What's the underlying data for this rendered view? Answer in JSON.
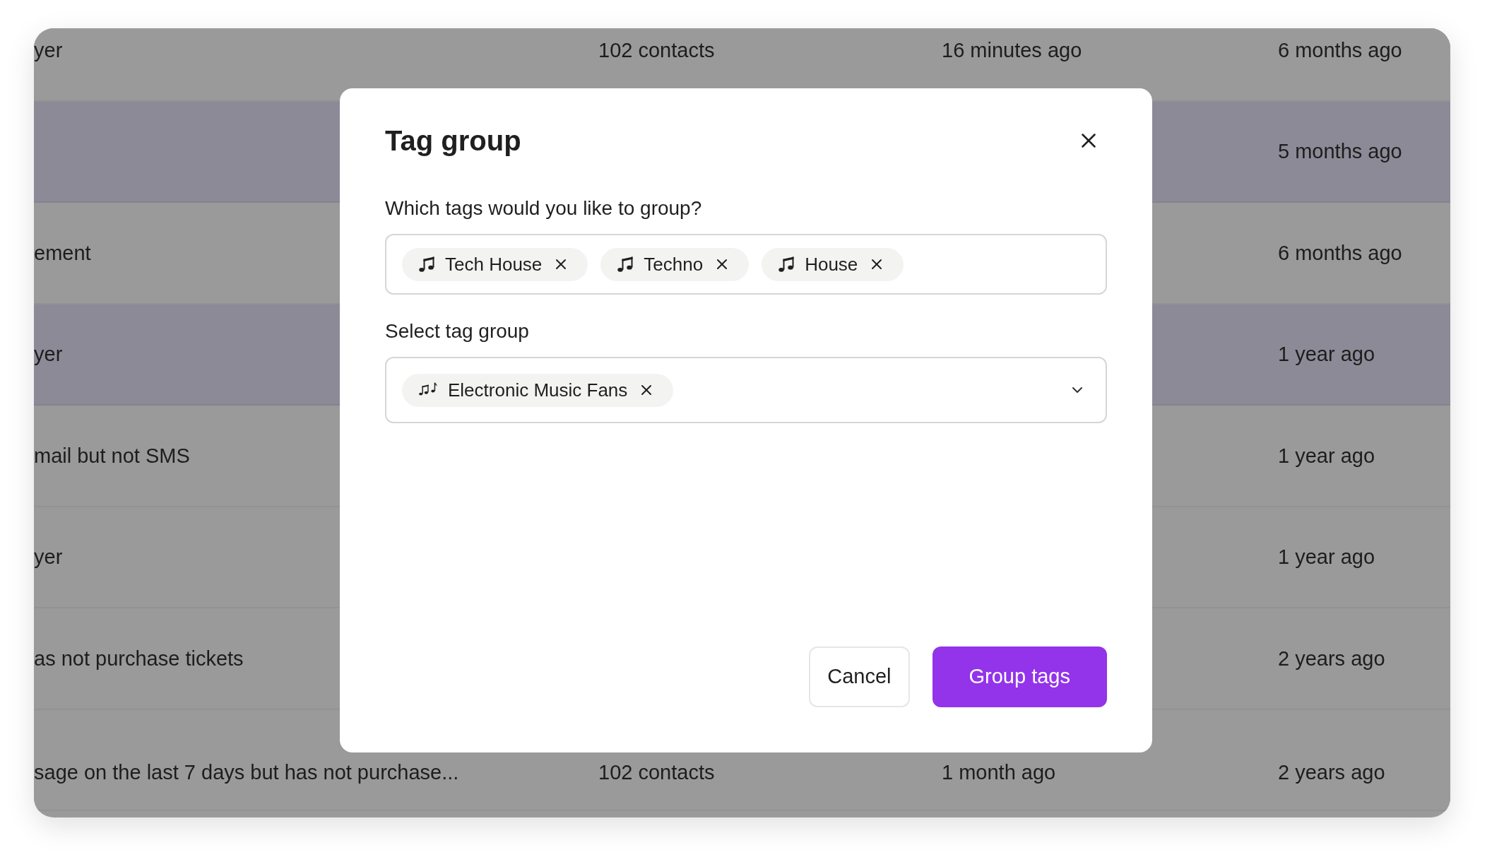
{
  "table": {
    "rows": [
      {
        "selected": false,
        "column_1": "yer",
        "column_2": "102 contacts",
        "column_3": "16 minutes ago",
        "column_4": "6 months ago"
      },
      {
        "selected": true,
        "column_4": "5 months ago"
      },
      {
        "selected": false,
        "column_1": "ement",
        "column_4": "6 months ago"
      },
      {
        "selected": true,
        "column_1": "yer",
        "column_4": "1 year ago"
      },
      {
        "selected": false,
        "column_1": "mail but not SMS",
        "column_4": "1 year ago"
      },
      {
        "selected": false,
        "column_1": "yer",
        "column_4": "1 year ago"
      },
      {
        "selected": false,
        "column_1": "as not purchase tickets",
        "column_4": "2 years ago"
      },
      {
        "selected": false,
        "column_1": "sage on the last 7 days but has not purchase...",
        "column_2": "102 contacts",
        "column_3": "1 month ago",
        "column_4": "2 years ago"
      }
    ]
  },
  "dialog": {
    "title": "Tag group",
    "tags_field": {
      "label": "Which tags would you like to group?",
      "tags": [
        "Tech House",
        "Techno",
        "House"
      ]
    },
    "group_field": {
      "label": "Select tag group",
      "value": "Electronic Music Fans"
    },
    "buttons": [
      {
        "kind": "secondary",
        "label": "Cancel"
      },
      {
        "kind": "primary",
        "label": "Group tags"
      }
    ]
  }
}
